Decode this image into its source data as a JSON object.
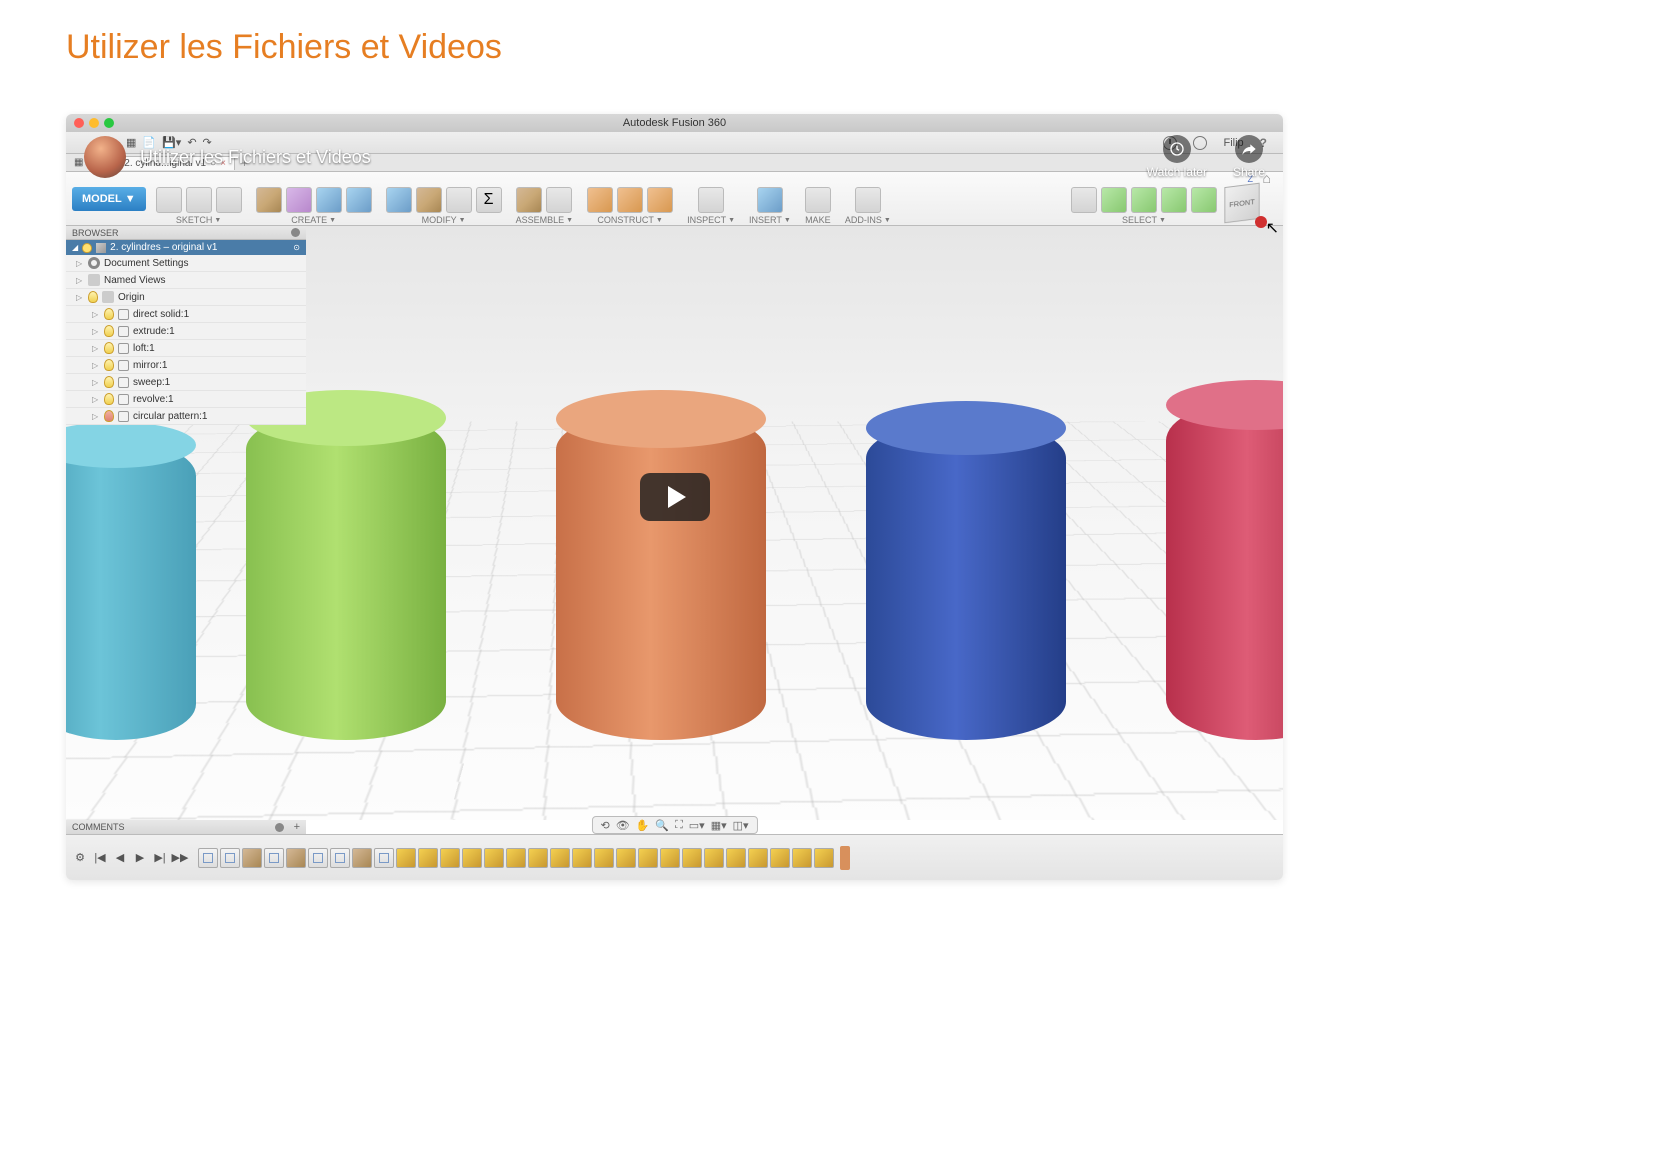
{
  "page": {
    "title": "Utilizer les Fichiers et Videos"
  },
  "mac_title": "Autodesk Fusion 360",
  "youtube": {
    "title": "Utilizer les Fichiers et Videos",
    "watch_later": "Watch later",
    "share": "Share"
  },
  "fusion_menu": {
    "user_name": "Filip",
    "tab": {
      "label": "2. cylind...iginal v1",
      "status": "○"
    }
  },
  "toolbar": {
    "model": "MODEL",
    "groups": [
      {
        "label": "SKETCH"
      },
      {
        "label": "CREATE"
      },
      {
        "label": "MODIFY"
      },
      {
        "label": "ASSEMBLE"
      },
      {
        "label": "CONSTRUCT"
      },
      {
        "label": "INSPECT"
      },
      {
        "label": "INSERT"
      },
      {
        "label": "MAKE"
      },
      {
        "label": "ADD-INS"
      },
      {
        "label": "SELECT"
      }
    ]
  },
  "browser": {
    "header": "BROWSER",
    "root": "2. cylindres – original v1",
    "items": [
      {
        "label": "Document Settings",
        "type": "gear"
      },
      {
        "label": "Named Views",
        "type": "folder"
      },
      {
        "label": "Origin",
        "type": "origin"
      }
    ],
    "children": [
      {
        "label": "direct solid:1"
      },
      {
        "label": "extrude:1"
      },
      {
        "label": "loft:1"
      },
      {
        "label": "mirror:1"
      },
      {
        "label": "sweep:1"
      },
      {
        "label": "revolve:1"
      },
      {
        "label": "circular pattern:1"
      }
    ]
  },
  "viewcube": {
    "face": "FRONT",
    "axis": "Z"
  },
  "comments": {
    "header": "COMMENTS"
  }
}
